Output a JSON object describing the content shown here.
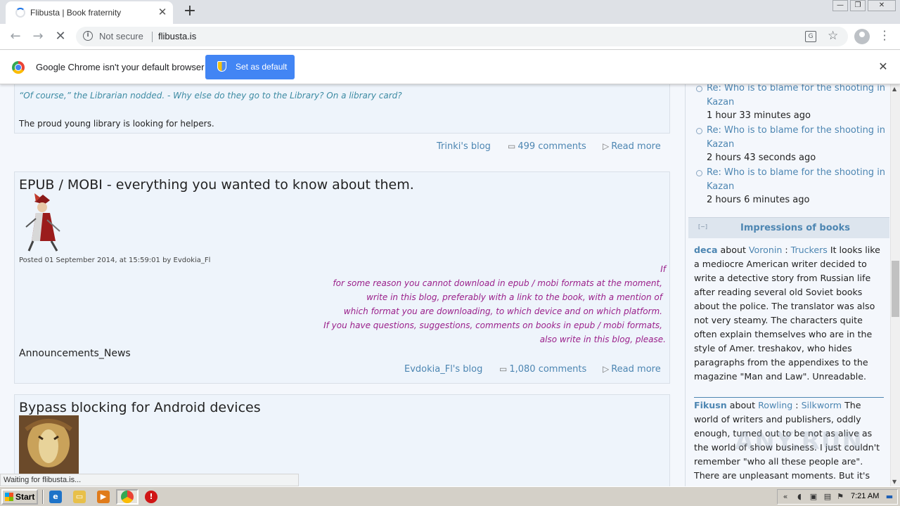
{
  "browser": {
    "tab_title": "Flibusta | Book fraternity",
    "security_label": "Not secure",
    "url": "flibusta.is",
    "infobar_text": "Google Chrome isn't your default browser",
    "set_default_label": "Set as default",
    "status_text": "Waiting for flibusta.is..."
  },
  "posts": [
    {
      "quote_line": "“Of course,” the Librarian nodded. - Why else do they go to the Library? On a library card?",
      "body": "The proud young library is looking for helpers.",
      "blog_link": "Trinki's blog",
      "comments": "499 comments",
      "read_more": "Read more"
    },
    {
      "title": "EPUB / MOBI - everything you wanted to know about them.",
      "posted": "Posted 01 September 2014, at 15:59:01 by Evdokia_Fl",
      "quote_lines": [
        "If",
        "for some reason you cannot download in epub / mobi formats at the moment,",
        "write in this blog, preferably with a link to the book, with a mention of",
        "which format you are downloading, to which device and on which platform.",
        "If you have questions, suggestions, comments on books in epub / mobi formats,",
        "also write in this blog, please."
      ],
      "section": "Announcements_News",
      "blog_link": "Evdokia_Fl's blog",
      "comments": "1,080 comments",
      "read_more": "Read more"
    },
    {
      "title": "Bypass blocking for Android devices"
    }
  ],
  "sidebar": {
    "comments": [
      {
        "title": "Re: Who is to blame for the shooting in Kazan",
        "time": "1 hour 33 minutes ago"
      },
      {
        "title": "Re: Who is to blame for the shooting in Kazan",
        "time": "2 hours 43 seconds ago"
      },
      {
        "title": "Re: Who is to blame for the shooting in Kazan",
        "time": "2 hours 6 minutes ago"
      }
    ],
    "collapse_label": "[−]",
    "impressions_title": "Impressions of books",
    "reviews": [
      {
        "user": "deca",
        "about": "about",
        "author": "Voronin",
        "colon": ":",
        "book": "Truckers",
        "text": "It looks like a mediocre American writer decided to write a detective story from Russian life after reading several old Soviet books about the police. The translator was also not very steamy. The characters quite often explain themselves who are in the style of Amer. treshakov, who hides paragraphs from the appendixes to the magazine \"Man and Law\". Unreadable."
      },
      {
        "user": "Fikusn",
        "about": "about",
        "author": "Rowling",
        "colon": ":",
        "book": "Silkworm",
        "text": "The world of writers and publishers, oddly enough, turned out to be not as alive as the world of show business. I just couldn't remember \"who all these people are\". There are unpleasant moments. But it's"
      }
    ],
    "watermark": "ANY.RUN"
  },
  "taskbar": {
    "start_label": "Start",
    "clock": "7:21 AM"
  }
}
